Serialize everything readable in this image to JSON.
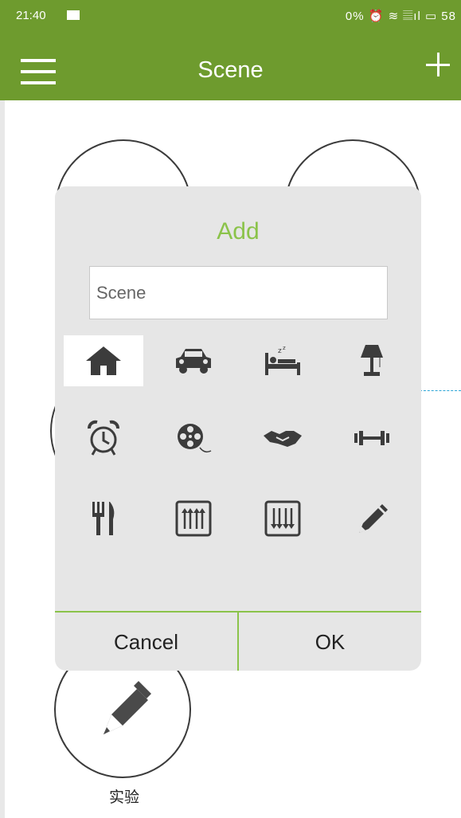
{
  "status": {
    "time": "21:40",
    "right_text": "0% ⏰ ≋ 𝄚ıl ▭ 58"
  },
  "appbar": {
    "title": "Scene"
  },
  "dialog": {
    "title": "Add",
    "name_value": "Scene",
    "icons": [
      "home-icon",
      "car-icon",
      "bed-icon",
      "lamp-icon",
      "alarm-clock-icon",
      "film-reel-icon",
      "handshake-icon",
      "dumbbell-icon",
      "fork-knife-icon",
      "equalizer-up-icon",
      "equalizer-down-icon",
      "pencil-icon"
    ],
    "selected_icon": "home-icon",
    "cancel_label": "Cancel",
    "ok_label": "OK"
  },
  "scenes": [
    {
      "label": "实验",
      "icon": "pencil-icon"
    }
  ]
}
